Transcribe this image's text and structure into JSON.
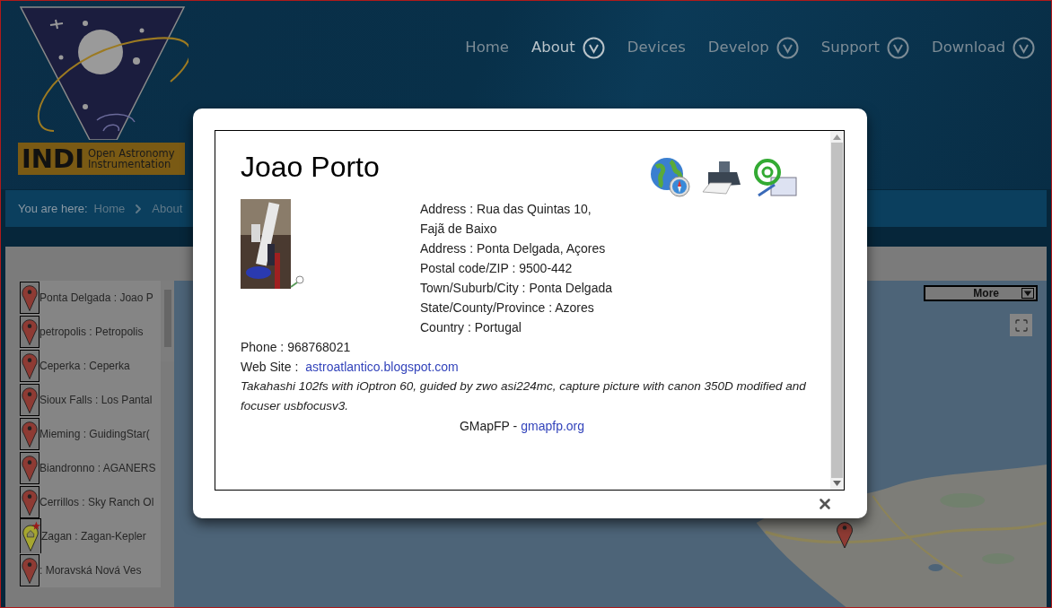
{
  "logo": {
    "mark": "INDI",
    "line_1": "Open Astronomy",
    "line_2": "Instrumentation"
  },
  "nav": [
    {
      "label": "Home",
      "selected": false,
      "dropdown": false
    },
    {
      "label": "About",
      "selected": true,
      "dropdown": true
    },
    {
      "label": "Devices",
      "selected": false,
      "dropdown": false
    },
    {
      "label": "Develop",
      "selected": false,
      "dropdown": true
    },
    {
      "label": "Support",
      "selected": false,
      "dropdown": true
    },
    {
      "label": "Download",
      "selected": false,
      "dropdown": true
    }
  ],
  "breadcrumb": {
    "label": "You are here:",
    "items": [
      "Home",
      "About"
    ]
  },
  "locations": [
    {
      "label": "Ponta Delgada : Joao P",
      "kind": "pin"
    },
    {
      "label": "petropolis : Petropolis",
      "kind": "pin"
    },
    {
      "label": "Ceperka : Ceperka",
      "kind": "pin"
    },
    {
      "label": "Sioux Falls : Los Pantal",
      "kind": "pin"
    },
    {
      "label": "Mieming : GuidingStar(",
      "kind": "pin"
    },
    {
      "label": "Biandronno : AGANERS",
      "kind": "pin"
    },
    {
      "label": "Cerrillos : Sky Ranch Ol",
      "kind": "pin"
    },
    {
      "label": "Zagan : Zagan-Kepler",
      "kind": "home"
    },
    {
      "label": ": Moravská Nová Ves",
      "kind": "pin"
    }
  ],
  "map": {
    "more_button": "More"
  },
  "popup": {
    "name": "Joao Porto",
    "address_lines": [
      "Address : Rua das Quintas 10,",
      "Fajã de Baixo",
      "Address : Ponta Delgada, Açores",
      "Postal code/ZIP : 9500-442",
      "Town/Suburb/City : Ponta Delgada",
      "State/County/Province : Azores",
      "Country : Portugal"
    ],
    "phone": "Phone : 968768021",
    "website_label": "Web Site :",
    "website": "astroatlantico.blogspot.com",
    "description": "Takahashi 102fs with iOptron 60, guided by zwo asi224mc, capture picture with canon 350D modified and focuser usbfocusv3.",
    "credit_label": "GMapFP -",
    "credit_link": "gmapfp.org"
  }
}
